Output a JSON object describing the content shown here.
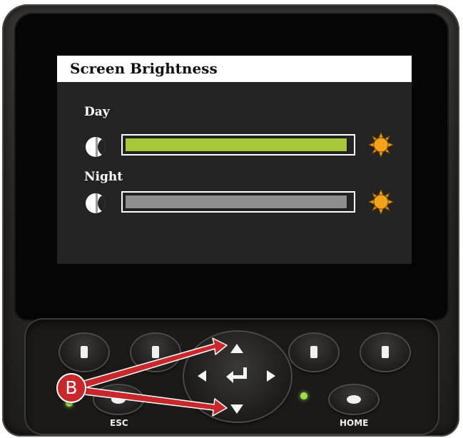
{
  "screen": {
    "title": "Screen Brightness",
    "rows": [
      {
        "label": "Day",
        "level": 0.98,
        "fill_color": "#a8c83a",
        "min_icon": "moon-icon",
        "max_icon": "sun-icon"
      },
      {
        "label": "Night",
        "level": 0.98,
        "fill_color": "#8e8e8e",
        "min_icon": "moon-icon",
        "max_icon": "sun-icon"
      }
    ]
  },
  "keypad": {
    "esc_label": "ESC",
    "home_label": "HOME",
    "icons": [
      "arrow-up-icon",
      "arrow-down-icon",
      "arrow-left-icon",
      "arrow-right-icon",
      "enter-icon"
    ],
    "led_color": "#9be04a"
  },
  "callout": {
    "letter": "B",
    "color": "#c8282c",
    "targets": [
      "arrow-up",
      "arrow-down"
    ]
  },
  "colors": {
    "screen_bg": "#232323",
    "title_bar_bg": "#ffffff",
    "sun": "#f3a21b"
  }
}
